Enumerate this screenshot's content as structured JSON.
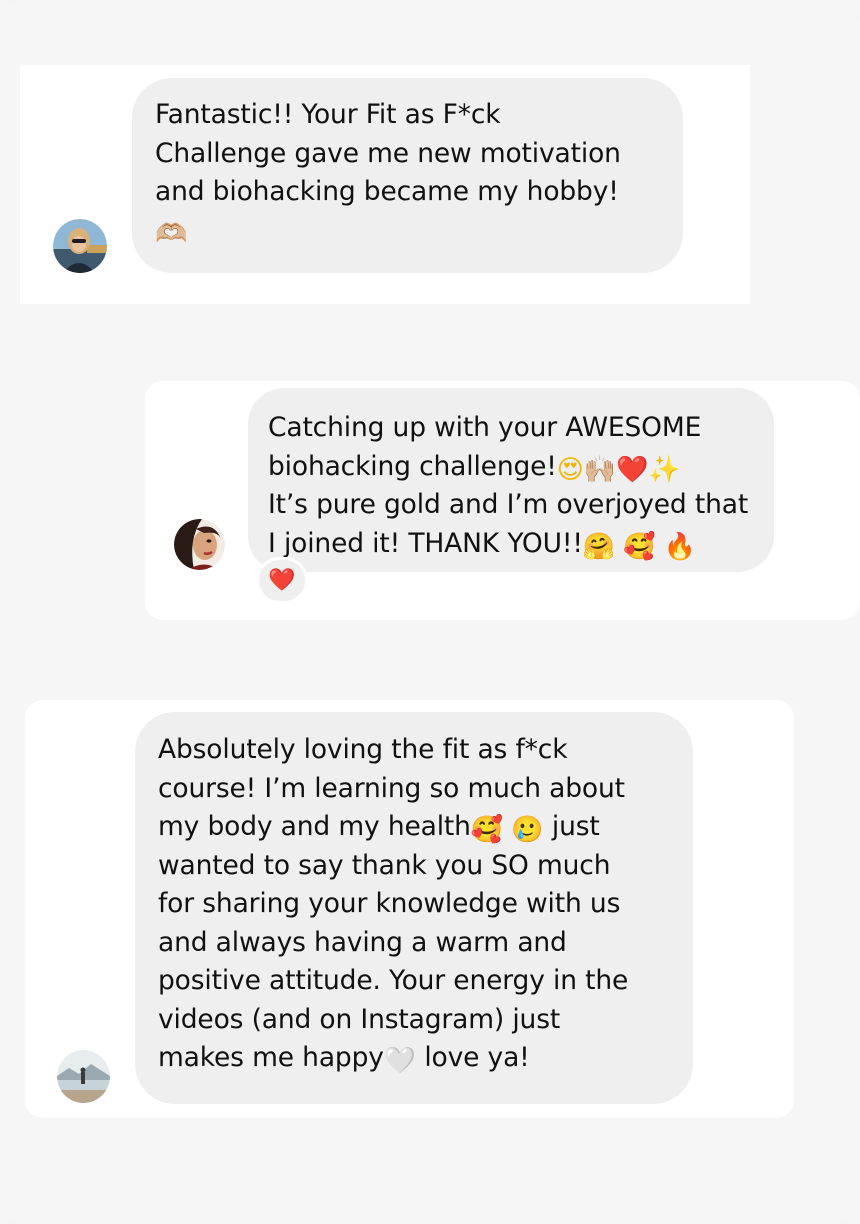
{
  "messages": [
    {
      "id": "msg1",
      "lines": [
        "Fantastic!! Your Fit as F*ck",
        "Challenge gave me new motivation",
        "and biohacking became my hobby!"
      ],
      "trailing_emoji": "🫶🏼",
      "avatar": "user-avatar-blonde-sunglasses"
    },
    {
      "id": "msg2",
      "line1": "Catching up with your AWESOME",
      "line2_text": "biohacking challenge!",
      "line2_emojis": [
        "😍",
        "🙌🏼",
        "❤️",
        "✨"
      ],
      "line3": "It’s pure gold and I’m overjoyed that",
      "line4_text": "I joined it! THANK YOU!!",
      "line4_emojis": [
        "🤗",
        "🥰",
        "🔥"
      ],
      "reaction": "❤️",
      "avatar": "user-avatar-illustrated-portrait"
    },
    {
      "id": "msg3",
      "line1": "Absolutely loving the fit as f*ck",
      "line2": "course! I’m learning so much about",
      "line3_text": "my body and my health",
      "line3_emojis": [
        "🥰",
        "🥲"
      ],
      "line3_tail": "just",
      "line4": "wanted to say thank you SO much",
      "line5": "for sharing your knowledge with us",
      "line6": "and always having a warm and",
      "line7": "positive attitude. Your energy in the",
      "line8": "videos (and on Instagram) just",
      "line9_text": "makes me happy",
      "line9_emoji": "🤍",
      "line9_tail": "love ya!",
      "avatar": "user-avatar-lake-landscape"
    }
  ],
  "colors": {
    "background": "#f6f6f6",
    "card": "#ffffff",
    "bubble": "#efefef",
    "text": "#111111",
    "heart": "#e8202f"
  }
}
